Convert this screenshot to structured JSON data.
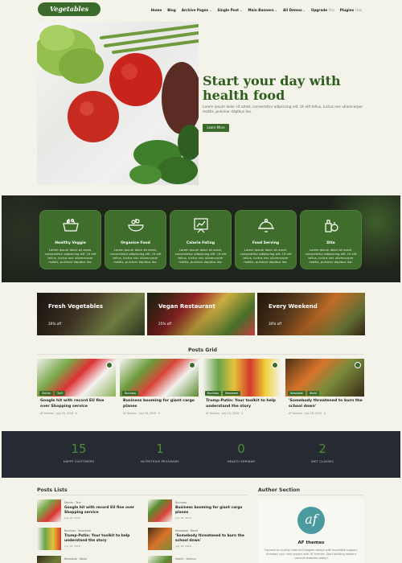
{
  "header": {
    "logo_text": "Vegetables",
    "nav": [
      {
        "label": "Home",
        "chev": false
      },
      {
        "label": "Blog",
        "chev": false
      },
      {
        "label": "Archive Pages",
        "chev": true
      },
      {
        "label": "Single Post",
        "chev": true
      },
      {
        "label": "Main Banners",
        "chev": true
      },
      {
        "label": "All Demos",
        "chev": true
      },
      {
        "label": "Upgrade",
        "chev": false,
        "extra": "Pro"
      },
      {
        "label": "Plugins",
        "chev": false,
        "extra": "Use"
      }
    ]
  },
  "hero": {
    "title": "Start your day with health food",
    "text": "Lorem ipsum dolor sit amet, consectetur adipiscing elit. Ut elit tellus, luctus nec ullamcorper mattis, pulvinar dapibus leo.",
    "button": "Learn More"
  },
  "features": [
    {
      "title": "Healthy Veggie",
      "icon": "basket-icon",
      "text": "Lorem ipsum dolor sit amet, consectetur adipiscing elit. Ut elit tellus, luctus nec ullamcorper mattis, pulvinar dapibus leo."
    },
    {
      "title": "Organice Food",
      "icon": "bowl-icon",
      "text": "Lorem ipsum dolor sit amet, consectetur adipiscing elit. Ut elit tellus, luctus nec ullamcorper mattis, pulvinar dapibus leo."
    },
    {
      "title": "Calorie Fating",
      "icon": "chart-board-icon",
      "text": "Lorem ipsum dolor sit amet, consectetur adipiscing elit. Ut elit tellus, luctus nec ullamcorper mattis, pulvinar dapibus leo."
    },
    {
      "title": "Food Serving",
      "icon": "cloche-icon",
      "text": "Lorem ipsum dolor sit amet, consectetur adipiscing elit. Ut elit tellus, luctus nec ullamcorper mattis, pulvinar dapibus leo."
    },
    {
      "title": "Dite",
      "icon": "groceries-icon",
      "text": "Lorem ipsum dolor sit amet, consectetur adipiscing elit. Ut elit tellus, luctus nec ullamcorper mattis, pulvinar dapibus leo."
    }
  ],
  "categories": [
    {
      "title": "Fresh Vegetables",
      "offer": "20% off"
    },
    {
      "title": "Vegan Restaurant",
      "offer": "25% off"
    },
    {
      "title": "Every Weekend",
      "offer": "30% off"
    }
  ],
  "posts_grid": {
    "title": "Posts Grid",
    "cards": [
      {
        "tags": [
          "Stories",
          "Tech"
        ],
        "title": "Google hit with record EU fine over Shopping service",
        "meta": "AF themes  ·  July 18, 2018  ·  0"
      },
      {
        "tags": [
          "Business"
        ],
        "title": "Business booming for giant cargo planes",
        "meta": "AF themes  ·  July 18, 2018  ·  0"
      },
      {
        "tags": [
          "Business",
          "Newsbeat"
        ],
        "title": "Trump-Putin: Your toolkit to help understand the story",
        "meta": "AF themes  ·  July 18, 2018  ·  0"
      },
      {
        "tags": [
          "Newsbeat",
          "World"
        ],
        "title": "'Somebody threatened to burn the school down'",
        "meta": "AF themes  ·  July 18, 2018  ·  0"
      }
    ]
  },
  "stats": [
    {
      "num": "15",
      "label": "HAPPY CUSTOMERS"
    },
    {
      "num": "1",
      "label": "NUTRITIOUS PROGRAMS"
    },
    {
      "num": "0",
      "label": "HEALTH SEMINAR"
    },
    {
      "num": "2",
      "label": "DIET CLASSES"
    }
  ],
  "posts_list": {
    "title": "Posts Lists",
    "items": [
      {
        "cat": "Stories  ·  Tech",
        "title": "Google hit with record EU fine over Shopping service",
        "meta": "July 18, 2018"
      },
      {
        "cat": "Business",
        "title": "Business booming for giant cargo planes",
        "meta": "July 18, 2018"
      },
      {
        "cat": "Business  ·  Newsbeat",
        "title": "Trump-Putin: Your toolkit to help understand the story",
        "meta": "July 18, 2018"
      },
      {
        "cat": "Newsbeat  ·  World",
        "title": "'Somebody threatened to burn the school down'",
        "meta": "July 18, 2018"
      },
      {
        "cat": "Newsbeat  ·  World",
        "title": "",
        "meta": ""
      },
      {
        "cat": "Health  ·  Science",
        "title": "",
        "meta": ""
      }
    ]
  },
  "author": {
    "section_title": "Author Section",
    "logo": "af",
    "name": "AF themes",
    "desc": "Focused on quality code and elegant design with incredible support. Kickstart your next project with AF themes. Start building modern creative websites today!"
  },
  "colors": {
    "accent": "#3b6b2a",
    "dark_band": "#262b33"
  }
}
